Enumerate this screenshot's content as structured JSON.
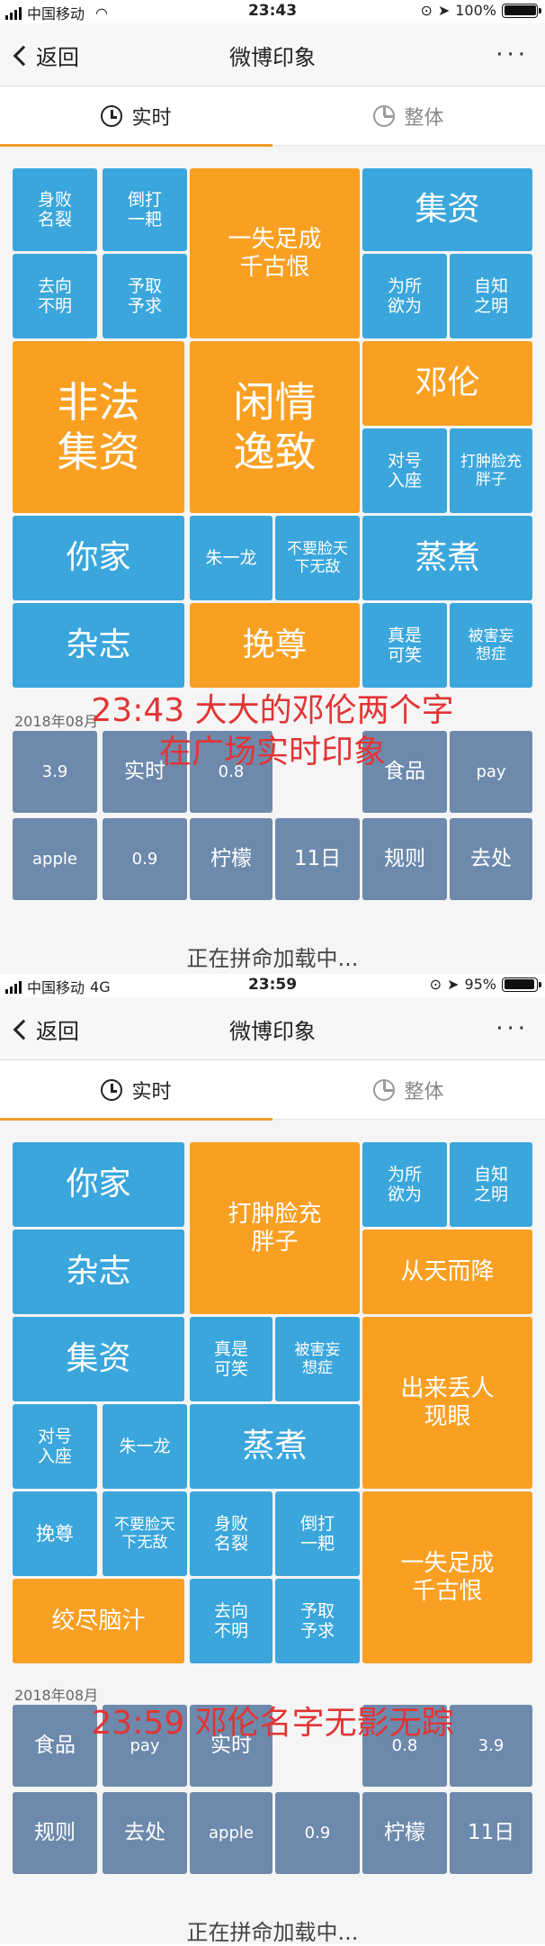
{
  "screens": [
    {
      "status": {
        "carrier": "中国移动",
        "network": "",
        "time": "23:43",
        "battery": "100%",
        "battery_level": 1.0
      },
      "nav": {
        "back_label": "返回",
        "title": "微博印象",
        "more": "···"
      },
      "tabs": [
        {
          "label": "实时",
          "icon": "clock-icon"
        },
        {
          "label": "整体",
          "icon": "pie-chart-icon"
        }
      ],
      "tiles": [
        "身败\n名裂",
        "倒打\n一耙",
        "一失足成\n千古恨",
        "集资",
        "去向\n不明",
        "予取\n予求",
        "为所\n欲为",
        "自知\n之明",
        "非法\n集资",
        "闲情\n逸致",
        "邓伦",
        "对号\n入座",
        "打肿脸充\n胖子",
        "你家",
        "朱一龙",
        "不要脸天\n下无敌",
        "蒸煮",
        "杂志",
        "挽尊",
        "真是\n可笑",
        "被害妄\n想症"
      ],
      "date": "2018年08月",
      "history_tiles": [
        "3.9",
        "实时",
        "0.8",
        "食品",
        "pay",
        "apple",
        "0.9",
        "柠檬",
        "11日",
        "规则",
        "去处"
      ],
      "loading": "正在拼命加载中...",
      "overlay": [
        "23:43 大大的邓伦两个字",
        "在广场实时印象"
      ]
    },
    {
      "status": {
        "carrier": "中国移动",
        "network": "4G",
        "time": "23:59",
        "battery": "95%",
        "battery_level": 0.95
      },
      "nav": {
        "back_label": "返回",
        "title": "微博印象",
        "more": "···"
      },
      "tabs": [
        {
          "label": "实时",
          "icon": "clock-icon"
        },
        {
          "label": "整体",
          "icon": "pie-chart-icon"
        }
      ],
      "tiles": [
        "你家",
        "打肿脸充\n胖子",
        "为所\n欲为",
        "自知\n之明",
        "杂志",
        "从天而降",
        "集资",
        "真是\n可笑",
        "被害妄\n想症",
        "出来丢人\n现眼",
        "对号\n入座",
        "朱一龙",
        "蒸煮",
        "挽尊",
        "不要脸天\n下无敌",
        "身败\n名裂",
        "倒打\n一耙",
        "一失足成\n千古恨",
        "绞尽脑汁",
        "去向\n不明",
        "予取\n予求"
      ],
      "date": "2018年08月",
      "history_tiles": [
        "食品",
        "pay",
        "实时",
        "0.8",
        "3.9",
        "规则",
        "去处",
        "apple",
        "0.9",
        "柠檬",
        "11日"
      ],
      "loading": "正在拼命加载中...",
      "overlay": [
        "23:59 邓伦名字无影无踪"
      ]
    }
  ],
  "colors": {
    "blue": "#3aa6dc",
    "orange": "#f9a023",
    "gray": "#6d8aad",
    "accent": "#f29a28",
    "overlay": "#e23434"
  }
}
